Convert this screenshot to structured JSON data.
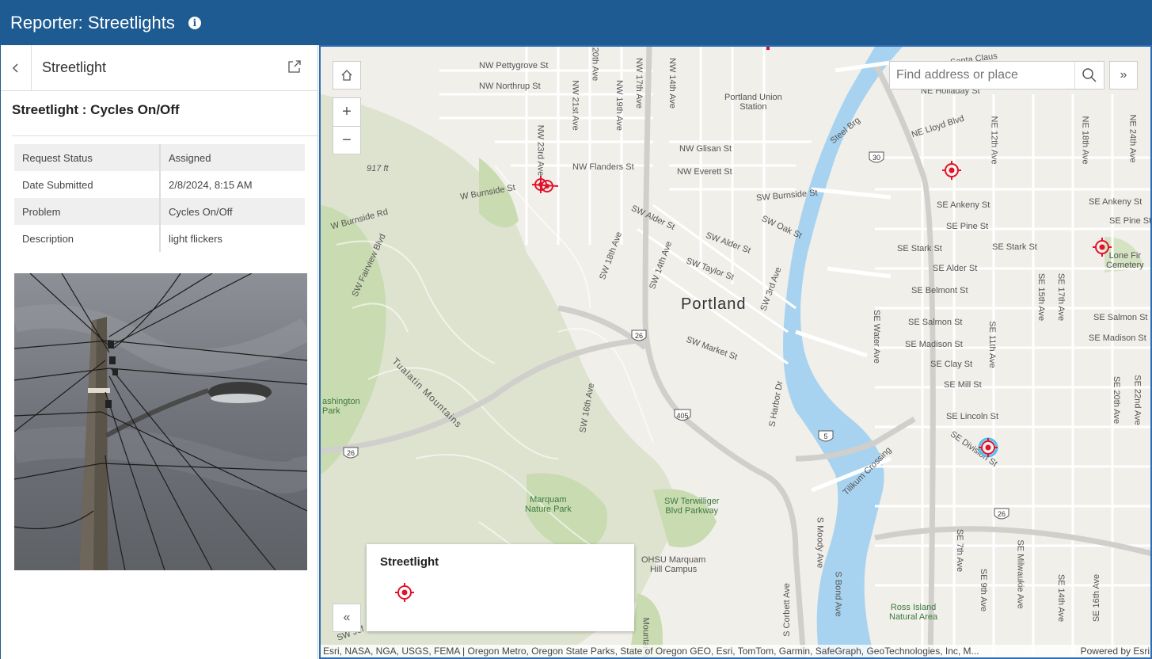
{
  "header": {
    "title": "Reporter: Streetlights",
    "info_icon": "info-icon"
  },
  "panel": {
    "title": "Streetlight",
    "feature_title": "Streetlight : Cycles On/Off",
    "attributes": [
      {
        "key": "Request Status",
        "value": "Assigned"
      },
      {
        "key": "Date Submitted",
        "value": "2/8/2024, 8:15 AM"
      },
      {
        "key": "Problem",
        "value": "Cycles On/Off"
      },
      {
        "key": "Description",
        "value": "light flickers"
      }
    ]
  },
  "map": {
    "search_placeholder": "Find address or place",
    "zoom_in": "+",
    "zoom_out": "−",
    "expand": "»",
    "collapse": "«",
    "legend_title": "Streetlight",
    "attribution": "Esri, NASA, NGA, USGS, FEMA | Oregon Metro, Oregon State Parks, State of Oregon GEO, Esri, TomTom, Garmin, SafeGraph, GeoTechnologies, Inc, M...",
    "powered_by": "Powered by Esri",
    "city_label": "Portland",
    "labels": {
      "nw_pettygrove": "NW Pettygrove St",
      "nw_northrup": "NW Northrup St",
      "nw_flanders": "NW Flanders St",
      "nw_glisan": "NW Glisan St",
      "nw_everett": "NW Everett St",
      "w_burnside": "W Burnside St",
      "w_burnside_rd": "W Burnside Rd",
      "sw_burnside": "SW Burnside St",
      "sw_alder": "SW Alder St",
      "sw_oak": "SW Oak St",
      "sw_alder2": "SW Alder St",
      "sw_taylor": "SW Taylor St",
      "sw_market": "SW Market St",
      "ne_holladay": "NE Holladay St",
      "ne_lloyd": "NE Lloyd Blvd",
      "se_ankeny": "SE Ankeny St",
      "se_ankeny2": "SE Ankeny St",
      "se_pine": "SE Pine St",
      "se_pine2": "SE Pine St",
      "se_stark": "SE Stark St",
      "se_stark2": "SE Stark St",
      "se_alder": "SE Alder St",
      "se_belmont": "SE Belmont St",
      "se_salmon": "SE Salmon St",
      "se_salmon2": "SE Salmon St",
      "se_madison": "SE Madison St",
      "se_madison2": "SE Madison St",
      "se_clay": "SE Clay St",
      "se_mill": "SE Mill St",
      "se_lincoln": "SE Lincoln St",
      "se_division": "SE Division St",
      "portland_union": "Portland Union\nStation",
      "steel_brg": "Steel Brg",
      "santa_claus": "Santa Claus",
      "elev": "917 ft",
      "tualatin": "Tualatin Mountains",
      "sw_fairview": "SW Fairview Blvd",
      "sw_18th": "SW 18th Ave",
      "sw_14th": "SW 14th Ave",
      "sw_3rd": "SW 3rd Ave",
      "sw_16th": "SW 16th Ave",
      "s_harbor": "S Harbor Dr",
      "tilikum": "Tilikum Crossing",
      "se_water": "SE Water Ave",
      "se_11th": "SE 11th Ave",
      "se_15th": "SE 15th Ave",
      "se_17th": "SE 17th Ave",
      "se_20th": "SE 20th Ave",
      "se_22nd": "SE 22nd Ave",
      "ne_12th": "NE 12th Ave",
      "ne_18th": "NE 18th Ave",
      "ne_24th": "NE 24th Ave",
      "nw_23rd": "NW 23rd Ave",
      "nw_21st": "NW 21st Ave",
      "nw_19th": "NW 19th Ave",
      "nw_17th": "NW 17th Ave",
      "nw_14th": "NW 14th Ave",
      "nw_20th": "20th Ave",
      "marquam": "Marquam\nNature Park",
      "terwilliger": "SW Terwilliger\nBlvd Parkway",
      "ohsu": "OHSU Marquam\nHill Campus",
      "washington_park": "ashington\nPark",
      "lone_fir": "Lone Fir\nCemetery",
      "ross_island": "Ross Island\nNatural Area",
      "s_moody": "S Moody Ave",
      "s_bond": "S Bond Ave",
      "s_corbett": "S Corbett Ave",
      "se_7th": "SE 7th Ave",
      "se_9th": "SE 9th Ave",
      "se_milwaukie": "SE Milwaukie Ave",
      "se_14th": "SE 14th Ave",
      "se_16th": "SE 16th Ave",
      "sw_jeff": "SW Jef",
      "mountains": "Mountains"
    },
    "shields": {
      "i405": "405",
      "us26a": "26",
      "us26b": "26",
      "us26c": "26",
      "us30": "30",
      "i5": "5"
    }
  },
  "colors": {
    "header_bg": "#1d5b92",
    "marker": "#e3122b",
    "marker_selected": "#4fc3f7",
    "water": "#a8d3f0",
    "park": "#c9dbb0"
  }
}
